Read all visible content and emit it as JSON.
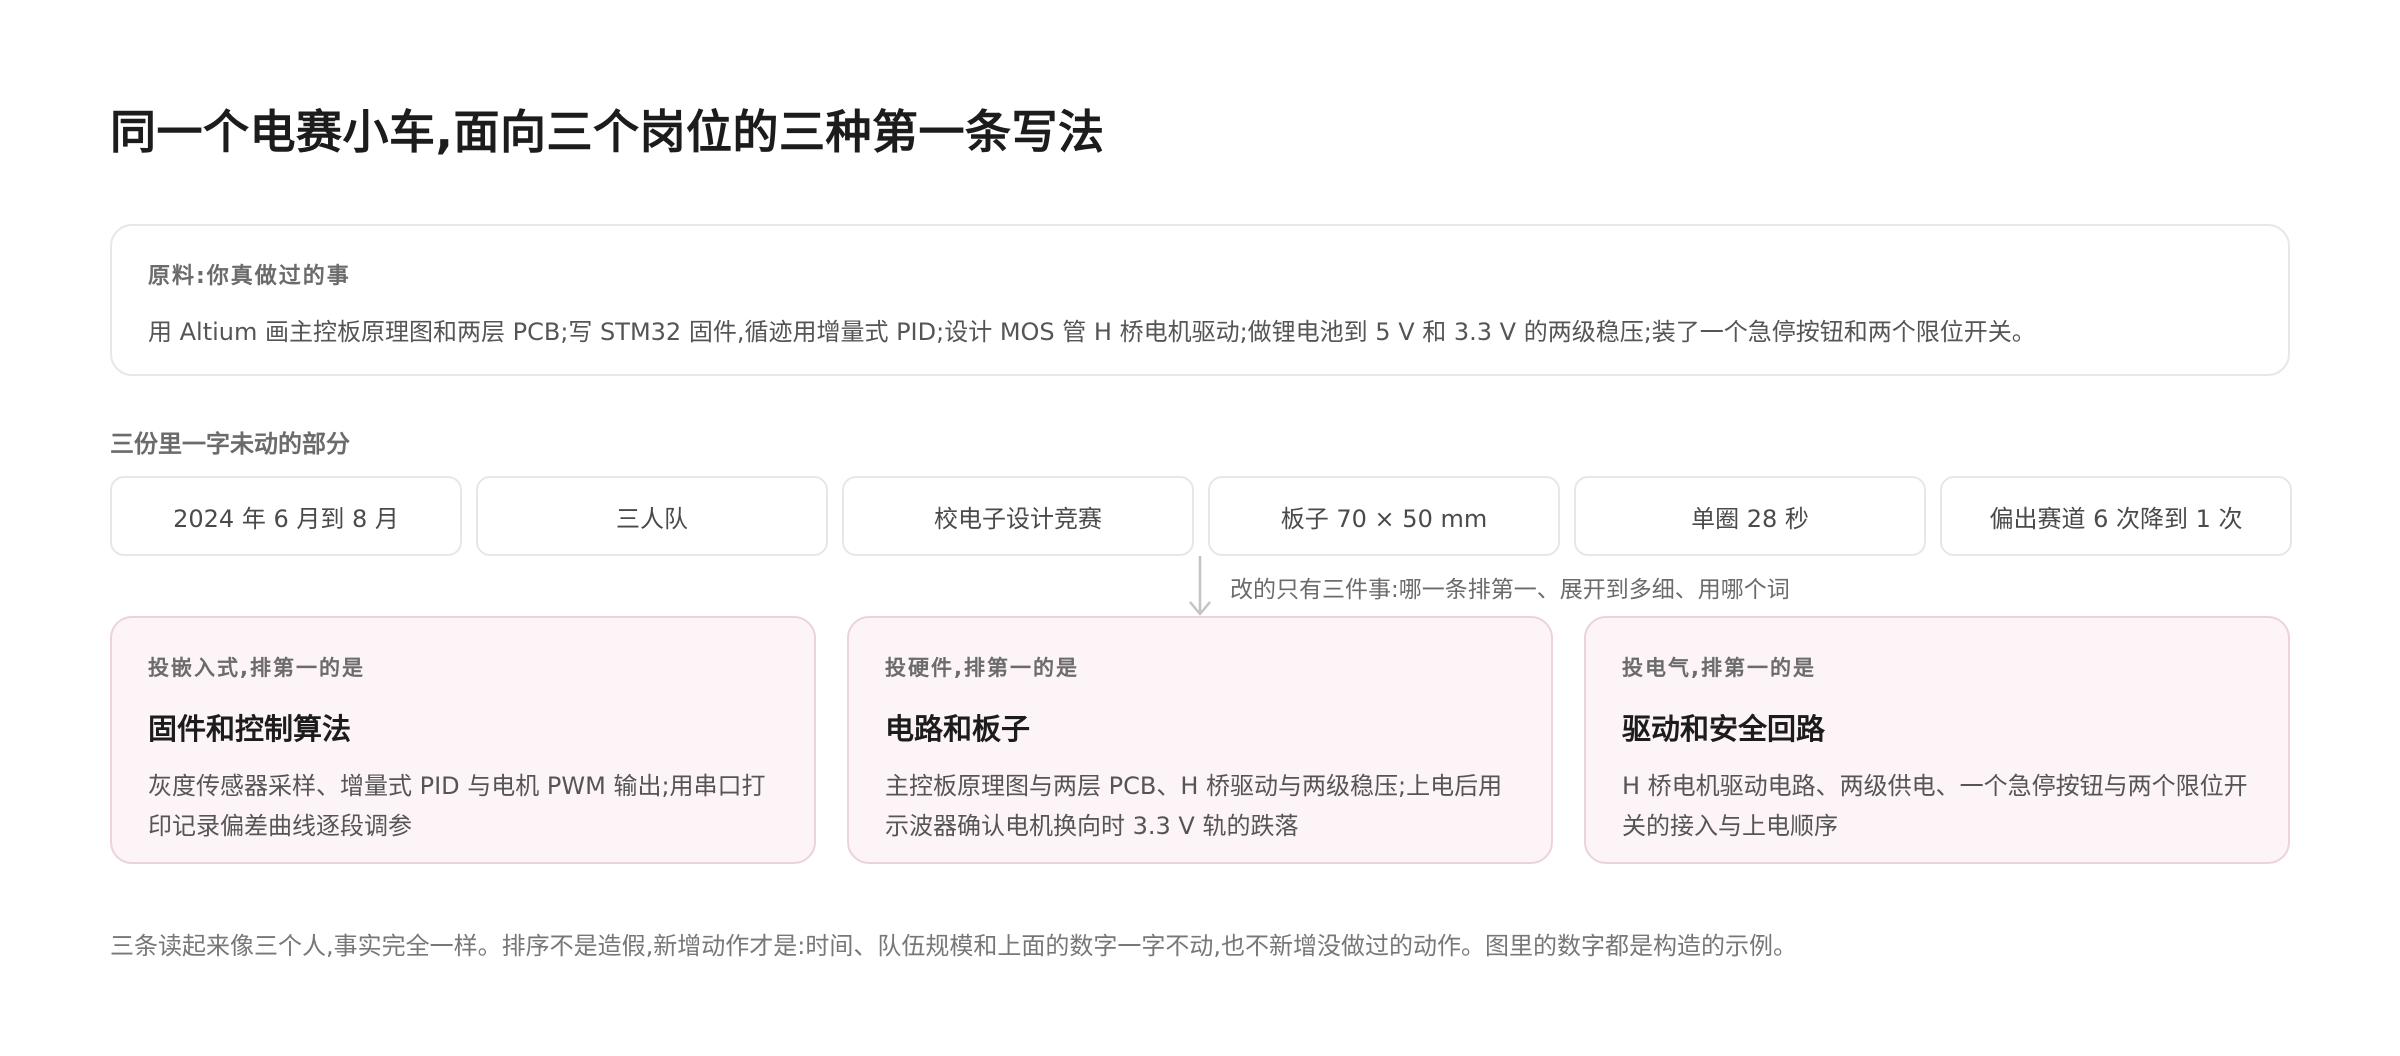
{
  "title": "同一个电赛小车,面向三个岗位的三种第一条写法",
  "source": {
    "label": "原料:你真做过的事",
    "text": "用 Altium 画主控板原理图和两层 PCB;写 STM32 固件,循迹用增量式 PID;设计 MOS 管 H 桥电机驱动;做锂电池到 5 V 和 3.3 V 的两级稳压;装了一个急停按钮和两个限位开关。"
  },
  "unchanged": {
    "label": "三份里一字未动的部分",
    "chips": [
      "2024 年 6 月到 8 月",
      "三人队",
      "校电子设计竞赛",
      "板子 70 × 50 mm",
      "单圈 28 秒",
      "偏出赛道 6 次降到 1 次"
    ]
  },
  "note": "改的只有三件事:哪一条排第一、展开到多细、用哪个词",
  "cards": [
    {
      "eyebrow": "投嵌入式,排第一的是",
      "title": "固件和控制算法",
      "body": "灰度传感器采样、增量式 PID 与电机 PWM 输出;用串口打印记录偏差曲线逐段调参"
    },
    {
      "eyebrow": "投硬件,排第一的是",
      "title": "电路和板子",
      "body": "主控板原理图与两层 PCB、H 桥驱动与两级稳压;上电后用示波器确认电机换向时 3.3 V 轨的跌落"
    },
    {
      "eyebrow": "投电气,排第一的是",
      "title": "驱动和安全回路",
      "body": "H 桥电机驱动电路、两级供电、一个急停按钮与两个限位开关的接入与上电顺序"
    }
  ],
  "footer": "三条读起来像三个人,事实完全一样。排序不是造假,新增动作才是:时间、队伍规模和上面的数字一字不动,也不新增没做过的动作。图里的数字都是构造的示例。"
}
